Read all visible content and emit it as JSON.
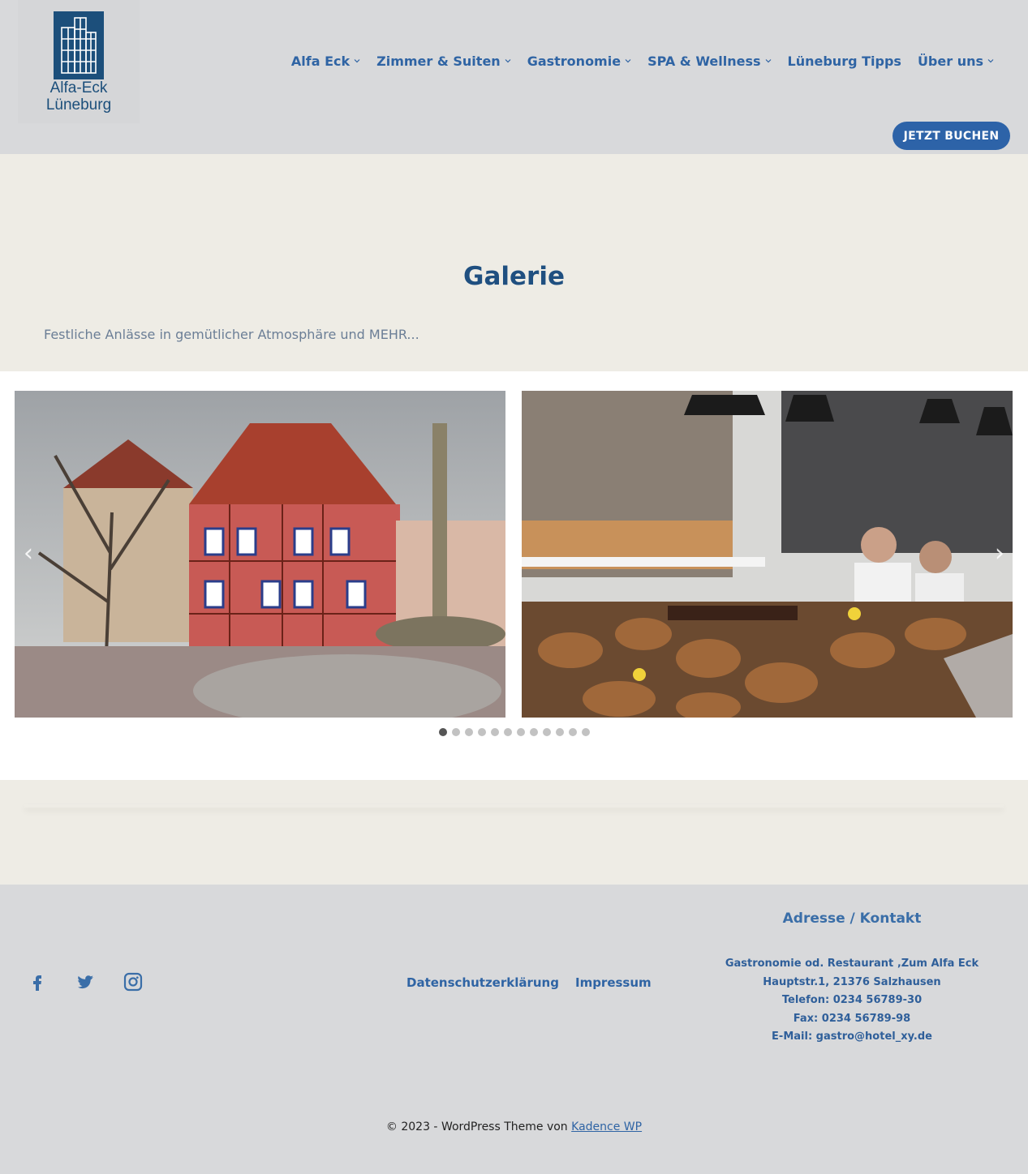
{
  "header": {
    "logo_line1": "Alfa-Eck",
    "logo_line2": "Lüneburg",
    "nav": [
      {
        "label": "Alfa Eck",
        "dropdown": true
      },
      {
        "label": "Zimmer & Suiten",
        "dropdown": true
      },
      {
        "label": "Gastronomie",
        "dropdown": true
      },
      {
        "label": "SPA & Wellness",
        "dropdown": true
      },
      {
        "label": "Lüneburg Tipps",
        "dropdown": false
      },
      {
        "label": "Über uns",
        "dropdown": true
      }
    ],
    "book_button": "JETZT BUCHEN"
  },
  "hero": {
    "title": "Galerie",
    "subtitle": "Festliche Anlässe in gemütlicher Atmosphäre und MEHR..."
  },
  "gallery": {
    "prev_icon": "chevron-left-icon",
    "next_icon": "chevron-right-icon",
    "dots_count": 12,
    "active_dot": 0
  },
  "footer": {
    "social": [
      "facebook-icon",
      "twitter-icon",
      "instagram-icon"
    ],
    "links": [
      "Datenschutzerklärung",
      "Impressum"
    ],
    "contact_title": "Adresse / Kontakt",
    "contact_lines": [
      "Gastronomie od. Restaurant ‚Zum Alfa Eck",
      "Hauptstr.1, 21376 Salzhausen",
      "Telefon: 0234 56789-30",
      "Fax: 0234 56789-98",
      "E-Mail: gastro@hotel_xy.de"
    ],
    "copyright_prefix": "© 2023 - WordPress Theme von ",
    "copyright_link": "Kadence WP"
  },
  "colors": {
    "accent": "#2d63a8",
    "header_bg": "#d8d9db",
    "hero_bg": "#eeece5",
    "title": "#1f4f80"
  }
}
